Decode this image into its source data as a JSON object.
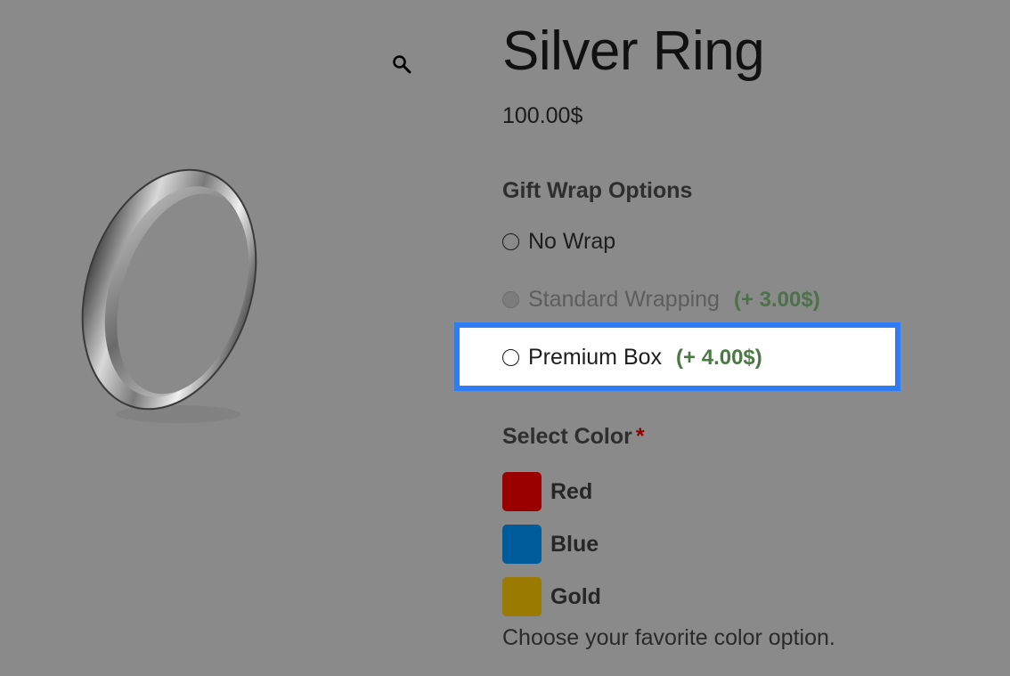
{
  "product": {
    "title": "Silver Ring",
    "price": "100.00$"
  },
  "gallery": {
    "zoom_icon": "magnifier-icon"
  },
  "gift_wrap": {
    "title": "Gift Wrap Options",
    "options": [
      {
        "label": "No Wrap",
        "addon": ""
      },
      {
        "label": "Standard Wrapping",
        "addon": "(+ 3.00$)",
        "disabled": true
      },
      {
        "label": "Premium Box",
        "addon": "(+ 4.00$)"
      }
    ]
  },
  "color": {
    "title": "Select Color",
    "required_mark": "*",
    "options": [
      {
        "label": "Red",
        "color": "#9b0000"
      },
      {
        "label": "Blue",
        "color": "#005b9a"
      },
      {
        "label": "Gold",
        "color": "#9a7a00"
      }
    ],
    "hint": "Choose your favorite color option."
  },
  "colors": {
    "overlay_bg": "#8a8a8a",
    "highlight_border": "#2f7df6",
    "addon_price": "#4a7a44",
    "required": "#8b0000"
  }
}
